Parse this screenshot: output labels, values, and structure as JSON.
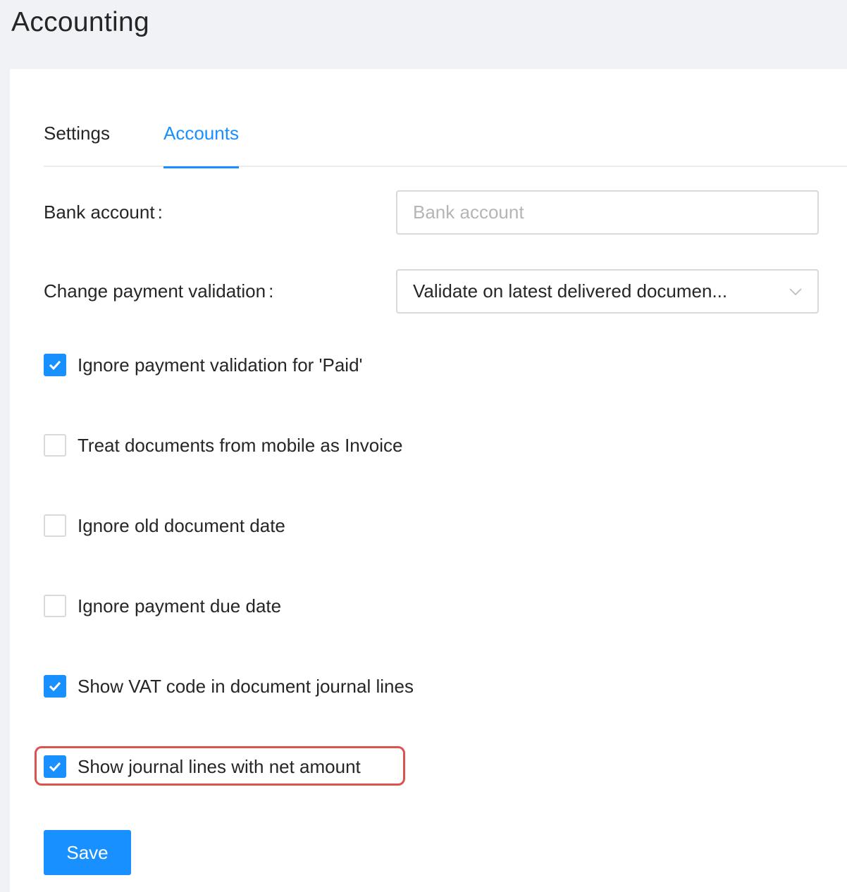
{
  "page": {
    "title": "Accounting"
  },
  "tabs": [
    {
      "label": "Settings",
      "active": false
    },
    {
      "label": "Accounts",
      "active": true
    }
  ],
  "form": {
    "bank_account": {
      "label": "Bank account",
      "colon": ":",
      "value": "",
      "placeholder": "Bank account"
    },
    "change_payment_validation": {
      "label": "Change payment validation",
      "colon": ":",
      "selected": "Validate on latest delivered documen..."
    }
  },
  "checkboxes": [
    {
      "label": "Ignore payment validation for 'Paid'",
      "checked": true
    },
    {
      "label": "Treat documents from mobile as Invoice",
      "checked": false
    },
    {
      "label": "Ignore old document date",
      "checked": false
    },
    {
      "label": "Ignore payment due date",
      "checked": false
    },
    {
      "label": "Show VAT code in document journal lines",
      "checked": true
    },
    {
      "label": "Show journal lines with net amount",
      "checked": true,
      "highlighted": true
    }
  ],
  "actions": {
    "save_label": "Save"
  },
  "colors": {
    "accent": "#1890ff",
    "highlight": "#d9534f",
    "background": "#f1f2f5"
  }
}
